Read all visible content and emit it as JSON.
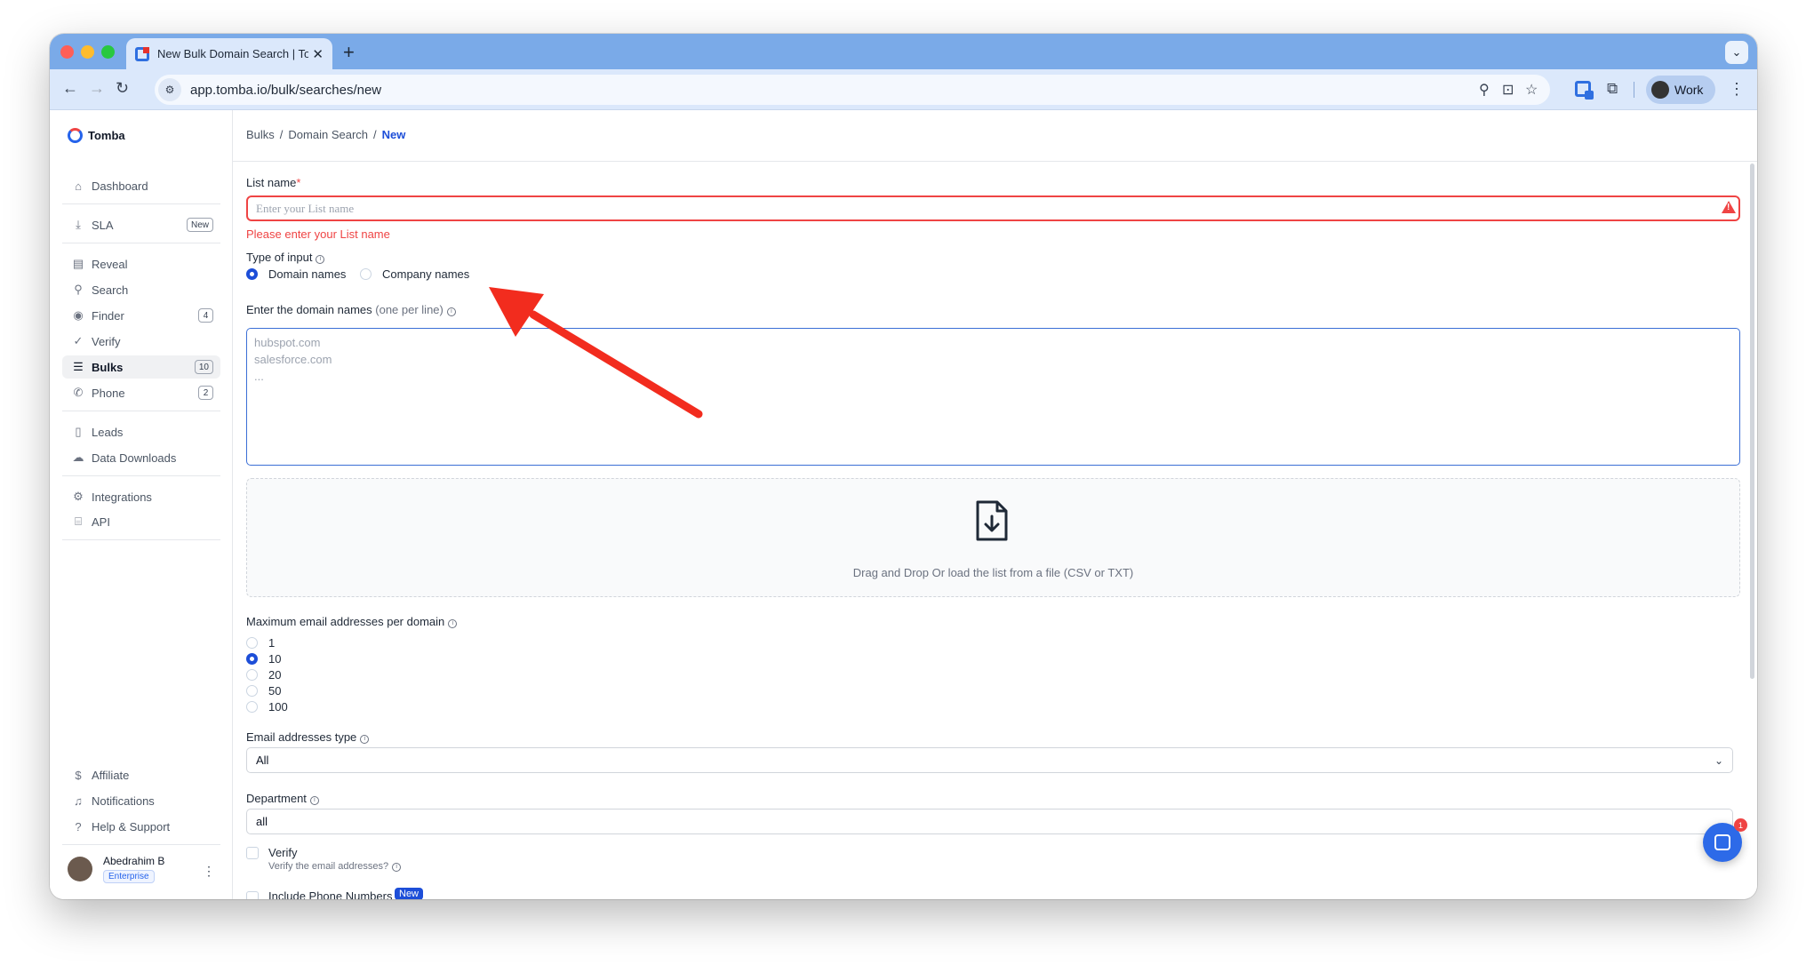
{
  "browser": {
    "tab_title": "New Bulk Domain Search | To",
    "url": "app.tomba.io/bulk/searches/new",
    "profile_label": "Work"
  },
  "sidebar": {
    "brand": "Tomba",
    "items": [
      {
        "label": "Dashboard",
        "icon": "home-icon"
      },
      {
        "label": "SLA",
        "icon": "download-icon",
        "badge": "New"
      },
      {
        "label": "Reveal",
        "icon": "building-icon"
      },
      {
        "label": "Search",
        "icon": "search-icon"
      },
      {
        "label": "Finder",
        "icon": "user-circle-icon",
        "badge": "4"
      },
      {
        "label": "Verify",
        "icon": "check-circle-icon"
      },
      {
        "label": "Bulks",
        "icon": "stack-icon",
        "badge": "10"
      },
      {
        "label": "Phone",
        "icon": "phone-icon",
        "badge": "2"
      },
      {
        "label": "Leads",
        "icon": "file-icon"
      },
      {
        "label": "Data Downloads",
        "icon": "cloud-icon"
      },
      {
        "label": "Integrations",
        "icon": "plug-icon"
      },
      {
        "label": "API",
        "icon": "code-icon"
      },
      {
        "label": "Affiliate",
        "icon": "dollar-icon"
      },
      {
        "label": "Notifications",
        "icon": "bell-icon"
      },
      {
        "label": "Help & Support",
        "icon": "help-icon"
      }
    ],
    "user": {
      "name": "Abedrahim B",
      "plan": "Enterprise"
    }
  },
  "breadcrumb": {
    "items": [
      "Bulks",
      "Domain Search",
      "New"
    ],
    "separator": "/"
  },
  "form": {
    "list_name": {
      "label": "List name",
      "required_mark": "*",
      "placeholder": "Enter your List name",
      "value": "",
      "error": "Please enter your List name"
    },
    "type_of_input": {
      "label": "Type of input",
      "options": [
        "Domain names",
        "Company names"
      ],
      "selected": "Domain names"
    },
    "domains": {
      "label": "Enter the domain names",
      "hint": "(one per line)",
      "placeholder": "hubspot.com\nsalesforce.com\n..."
    },
    "dropzone": {
      "text": "Drag and Drop Or load the list from a file (CSV or TXT)"
    },
    "max_emails": {
      "label": "Maximum email addresses per domain",
      "options": [
        "1",
        "10",
        "20",
        "50",
        "100"
      ],
      "selected": "10"
    },
    "email_type": {
      "label": "Email addresses type",
      "value": "All"
    },
    "department": {
      "label": "Department",
      "value": "all"
    },
    "verify": {
      "label": "Verify",
      "description": "Verify the email addresses?"
    },
    "include_phone": {
      "label": "Include Phone Numbers",
      "badge": "New"
    }
  },
  "chat": {
    "unread": "1"
  },
  "colors": {
    "accent": "#1d4ed8",
    "error": "#ef4444",
    "arrow": "#f22c1e",
    "tab_strip": "#7aaae8"
  }
}
